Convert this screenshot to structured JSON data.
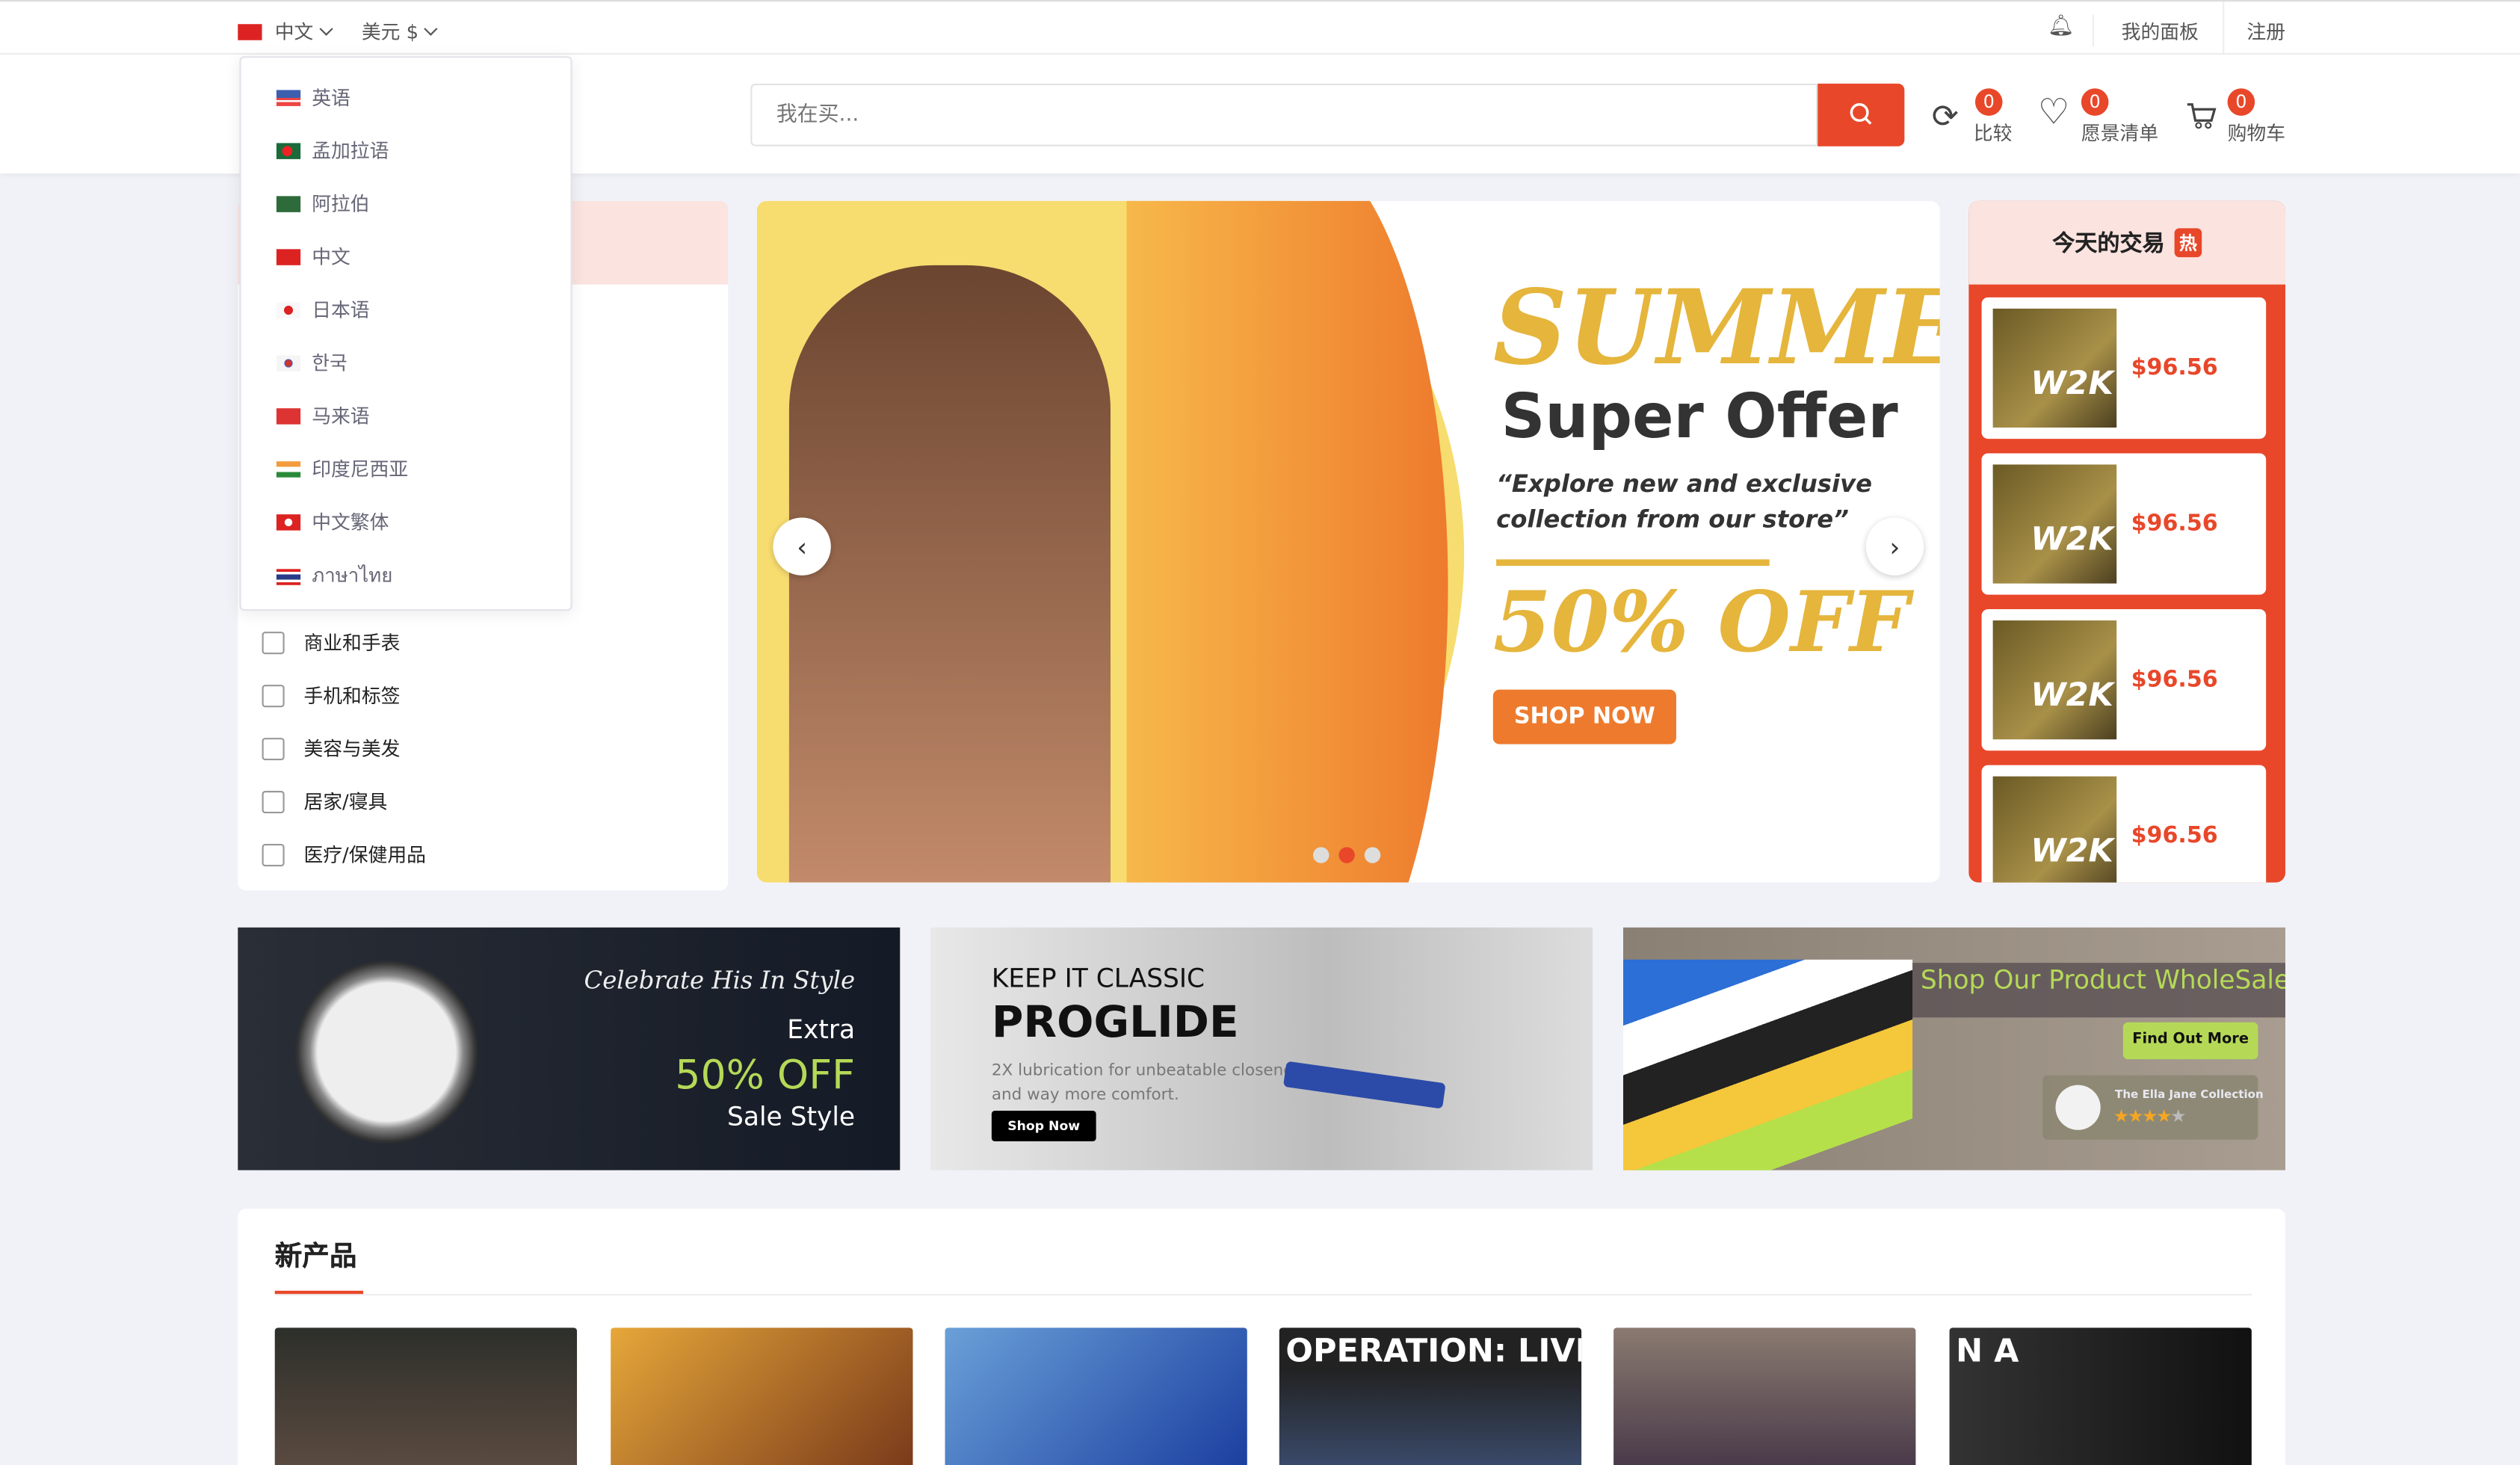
{
  "topbar": {
    "language": "中文",
    "currency": "美元 $",
    "dashboard": "我的面板",
    "register": "注册"
  },
  "language_menu": [
    {
      "label": "英语",
      "flag": "us"
    },
    {
      "label": "孟加拉语",
      "flag": "bd"
    },
    {
      "label": "阿拉伯",
      "flag": "sa"
    },
    {
      "label": "中文",
      "flag": "cn"
    },
    {
      "label": "日本语",
      "flag": "jp"
    },
    {
      "label": "한국",
      "flag": "kr"
    },
    {
      "label": "马来语",
      "flag": "my"
    },
    {
      "label": "印度尼西亚",
      "flag": "in"
    },
    {
      "label": "中文繁体",
      "flag": "hk"
    },
    {
      "label": "ภาษาไทย",
      "flag": "th"
    }
  ],
  "header": {
    "search_placeholder": "我在买...",
    "compare": {
      "label": "比较",
      "count": "0"
    },
    "wishlist": {
      "label": "愿景清单",
      "count": "0"
    },
    "cart": {
      "label": "购物车",
      "count": "0"
    }
  },
  "categories": [
    {
      "label": "商业和手表",
      "icon": "watch-icon"
    },
    {
      "label": "手机和标签",
      "icon": "phone-icon"
    },
    {
      "label": "美容与美发",
      "icon": "cosmetics-icon"
    },
    {
      "label": "居家/寝具",
      "icon": "furniture-icon"
    },
    {
      "label": "医疗/保健用品",
      "icon": "syringe-icon"
    }
  ],
  "hero": {
    "title": "SUMMER",
    "subtitle": "Super Offer",
    "quote": "“Explore new and exclusive collection from our store”",
    "discount": "50% OFF",
    "cta": "SHOP NOW",
    "slide_count": 3,
    "active_slide": 2
  },
  "deals": {
    "title": "今天的交易",
    "hot_badge": "热",
    "items": [
      {
        "image_text": "W2K",
        "price": "$96.56"
      },
      {
        "image_text": "W2K",
        "price": "$96.56"
      },
      {
        "image_text": "W2K",
        "price": "$96.56"
      },
      {
        "image_text": "W2K",
        "price": "$96.56"
      }
    ]
  },
  "banners": [
    {
      "line1": "Celebrate His In Style",
      "line2": "Extra",
      "line3": "50% OFF",
      "line4": "Sale Style"
    },
    {
      "line1": "KEEP IT CLASSIC",
      "line2": "PROGLIDE",
      "line3": "2X lubrication for unbeatable closeness and way more comfort.",
      "cta": "Shop Now"
    },
    {
      "line1": "Shop Our Product WholeSale",
      "cta": "Find Out More",
      "brand": "The Ella Jane Collection",
      "rating": 4,
      "rating_max": 5
    }
  ],
  "new_products": {
    "title": "新产品",
    "items": [
      {
        "image_text": ""
      },
      {
        "image_text": ""
      },
      {
        "image_text": ""
      },
      {
        "image_text": "OPERATION: LIVEWIRE"
      },
      {
        "image_text": ""
      },
      {
        "image_text": "N A"
      }
    ]
  },
  "colors": {
    "accent": "#e8472a",
    "pink": "#fbe3df",
    "lime": "#b5d957",
    "gold": "#e5b53c"
  }
}
